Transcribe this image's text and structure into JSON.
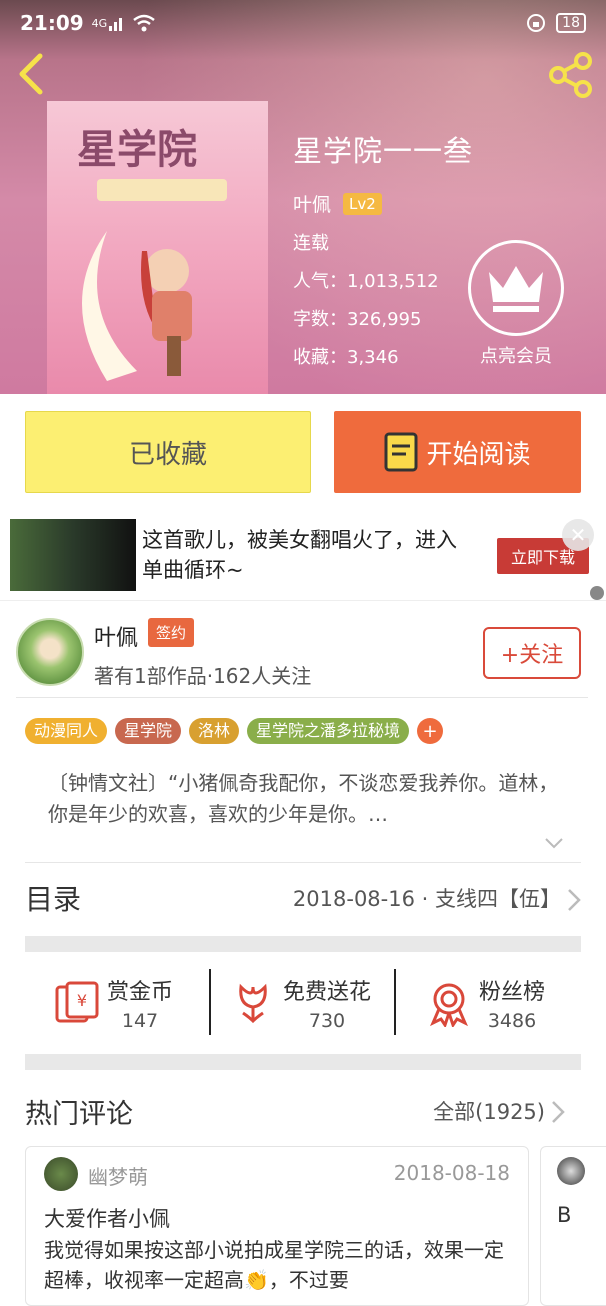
{
  "status": {
    "time": "21:09",
    "network": "4G",
    "battery": "18"
  },
  "book": {
    "title": "星学院一一叁",
    "author": "叶佩",
    "level": "Lv2",
    "state": "连载",
    "popularity_label": "人气：",
    "popularity": "1,013,512",
    "words_label": "字数：",
    "words": "326,995",
    "favorites_label": "收藏：",
    "favorites": "3,346",
    "vip_label": "点亮会员"
  },
  "actions": {
    "fav_label": "已收藏",
    "read_label": "开始阅读"
  },
  "ad": {
    "text": "这首歌儿，被美女翻唱火了，进入单曲循环~",
    "download_label": "立即下载"
  },
  "author_box": {
    "name": "叶佩",
    "sign_badge": "签约",
    "meta": "著有1部作品·162人关注",
    "follow_label": "+关注"
  },
  "tags": [
    {
      "label": "动漫同人",
      "color": "#f0b030"
    },
    {
      "label": "星学院",
      "color": "#c8684f"
    },
    {
      "label": "洛林",
      "color": "#d8a030"
    },
    {
      "label": "星学院之潘多拉秘境",
      "color": "#8aae4a"
    }
  ],
  "intro": "〔钟情文社〕“小猪佩奇我配你，不谈恋爱我养你。道林，你是年少的欢喜，喜欢的少年是你。…",
  "toc": {
    "title": "目录",
    "latest": "2018-08-16 · 支线四【伍】"
  },
  "stats": [
    {
      "label": "赏金币",
      "value": "147",
      "icon": "red-envelope-icon"
    },
    {
      "label": "免费送花",
      "value": "730",
      "icon": "flower-icon"
    },
    {
      "label": "粉丝榜",
      "value": "3486",
      "icon": "medal-icon"
    }
  ],
  "hot": {
    "title": "热门评论",
    "all_label": "全部(1925)"
  },
  "comment": {
    "user": "幽梦萌",
    "date": "2018-08-18",
    "title": "大爱作者小佩",
    "body": "我觉得如果按这部小说拍成星学院三的话，效果一定超棒，收视率一定超高👏，不过要"
  },
  "comment2": {
    "text": "B"
  },
  "colors": {
    "accent": "#ef6b3d",
    "fav_bg": "#fcef72",
    "follow": "#d94a3a"
  }
}
